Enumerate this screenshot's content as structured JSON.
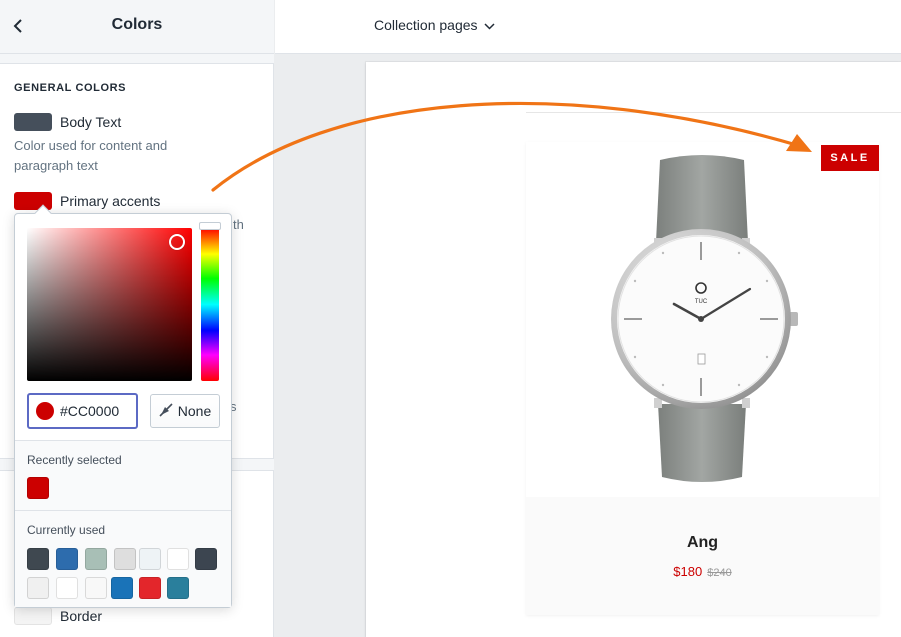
{
  "sidebar": {
    "title": "Colors",
    "section_label": "GENERAL COLORS",
    "body_text": {
      "label": "Body Text",
      "help": "Color used for content and paragraph text",
      "color": "#454f5b"
    },
    "primary_accents": {
      "label": "Primary accents",
      "color": "#cc0000"
    },
    "obscured_fragment_1": "th",
    "obscured_fragment_2": "s",
    "border": {
      "label": "Border",
      "color": "#f4f4f4"
    }
  },
  "topbar": {
    "page_select": "Collection pages"
  },
  "color_picker": {
    "hex_value": "#CC0000",
    "none_label": "None",
    "recently_selected_label": "Recently selected",
    "recently_selected": [
      "#cc0000"
    ],
    "currently_used_label": "Currently used",
    "currently_used": [
      "#3f4850",
      "#2d6cad",
      "#a8bfb6",
      "#dedede",
      "#eef3f6",
      "#ffffff",
      "#3c4550",
      "#f0f0f0",
      "#ffffff",
      "#f8f8f8",
      "#1a73b8",
      "#e3262b",
      "#2a7f9c"
    ]
  },
  "preview": {
    "badge": "SALE",
    "product_name": "Ang",
    "price": "$180",
    "compare_price": "$240"
  },
  "colors": {
    "annotation_arrow": "#f07416",
    "accent": "#cc0000",
    "focus": "#5c6ac4"
  },
  "icons": [
    "chevron-left-icon",
    "chevron-down-icon",
    "no-color-icon"
  ]
}
